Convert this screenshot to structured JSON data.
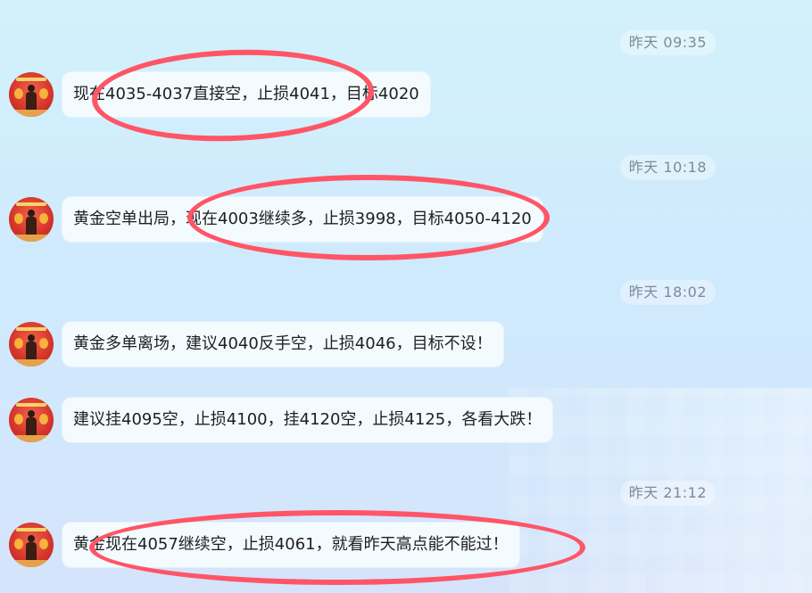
{
  "messages": [
    {
      "time": "昨天 09:35",
      "text": "现在4035-4037直接空，止损4041，目标4020"
    },
    {
      "time": "昨天 10:18",
      "text": "黄金空单出局，现在4003继续多，止损3998，目标4050-4120"
    },
    {
      "time": "昨天 18:02",
      "text": "黄金多单离场，建议4040反手空，止损4046，目标不设！"
    },
    {
      "time": "",
      "text": "建议挂4095空，止损4100，挂4120空，止损4125，各看大跌！"
    },
    {
      "time": "昨天 21:12",
      "text": "黄金现在4057继续空，止损4061，就看昨天高点能不能过！"
    }
  ],
  "annotation_color": "#ff5566",
  "avatar_icon": "avatar-photo-red-background"
}
